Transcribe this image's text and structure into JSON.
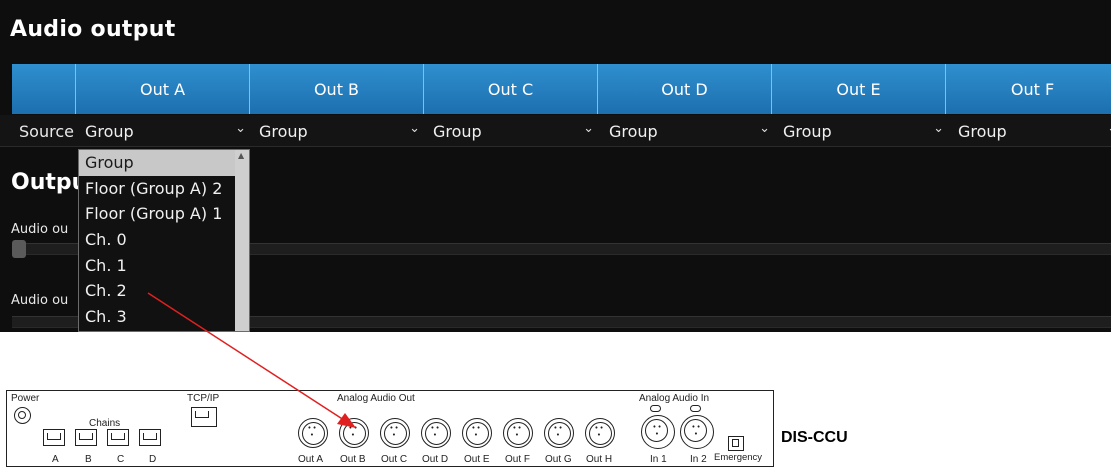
{
  "panel": {
    "title": "Audio output",
    "tabs": [
      "Out A",
      "Out B",
      "Out C",
      "Out D",
      "Out E",
      "Out F"
    ],
    "source_label": "Source",
    "selects": [
      "Group",
      "Group",
      "Group",
      "Group",
      "Group",
      "Group"
    ],
    "output_heading": "Outpu",
    "volume_labels": [
      "Audio ou",
      "Audio ou"
    ]
  },
  "dropdown": {
    "options": [
      "Group",
      "Floor (Group A) 2",
      "Floor (Group A) 1",
      "Ch. 0",
      "Ch. 1",
      "Ch. 2",
      "Ch. 3"
    ],
    "selected_index": 0
  },
  "hardware": {
    "power_label": "Power",
    "chains_label": "Chains",
    "chain_ports": [
      "A",
      "B",
      "C",
      "D"
    ],
    "tcpip_label": "TCP/IP",
    "analog_out_label": "Analog Audio Out",
    "outputs": [
      "Out A",
      "Out B",
      "Out C",
      "Out D",
      "Out E",
      "Out F",
      "Out G",
      "Out H"
    ],
    "analog_in_label": "Analog Audio In",
    "inputs": [
      "In 1",
      "In 2"
    ],
    "emergency_label": "Emergency",
    "device_name": "DIS-CCU"
  },
  "colors": {
    "panel_bg": "#0e0e0e",
    "tab_blue": "#2a86c8",
    "arrow": "#e02020"
  },
  "icons": {
    "select_chevron": "chevron-down-icon",
    "arrow": "callout-arrow-icon"
  }
}
